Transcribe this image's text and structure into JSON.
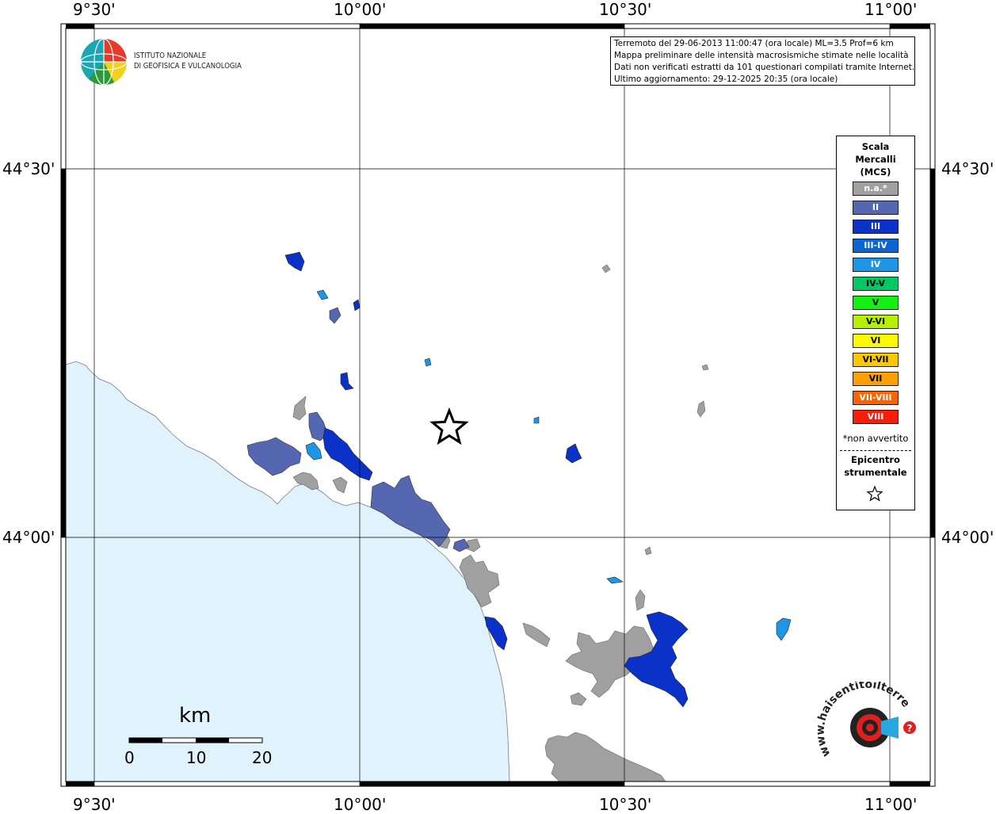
{
  "map": {
    "lon_labels": [
      "9°30'",
      "10°00'",
      "10°30'",
      "11°00'"
    ],
    "lat_labels": [
      "44°30'",
      "44°00'"
    ],
    "colors": {
      "sea": "#e0f2fc",
      "land": "#ffffff",
      "not_felt": "#a0a0a0",
      "II": "#5567b0",
      "III": "#0a32c8",
      "IV": "#1e96e6"
    }
  },
  "org": {
    "name_line1": "ISTITUTO NAZIONALE",
    "name_line2": "DI GEOFISICA E VULCANOLOGIA"
  },
  "info": {
    "line1": "Terremoto del 29-06-2013 11:00:47 (ora locale) ML=3.5 Prof=6 km",
    "line2": "Mappa preliminare delle intensità macrosismiche stimate nelle località",
    "line3": "Dati non verificati estratti da 101 questionari compilati tramite Internet.",
    "line4": "Ultimo aggiornamento: 29-12-2025 20:35 (ora locale)"
  },
  "legend": {
    "title_line1": "Scala",
    "title_line2": "Mercalli",
    "title_line3": "(MCS)",
    "classes": [
      {
        "label": "n.a.*",
        "color": "#a0a0a0",
        "text_color": "#ffffff"
      },
      {
        "label": "II",
        "color": "#5567b0",
        "text_color": "#ffffff"
      },
      {
        "label": "III",
        "color": "#0a32c8",
        "text_color": "#ffffff"
      },
      {
        "label": "III-IV",
        "color": "#0a64d2",
        "text_color": "#ffffff"
      },
      {
        "label": "IV",
        "color": "#1e96e6",
        "text_color": "#ffffff"
      },
      {
        "label": "IV-V",
        "color": "#00c864",
        "text_color": "#000000"
      },
      {
        "label": "V",
        "color": "#14f014",
        "text_color": "#000000"
      },
      {
        "label": "V-VI",
        "color": "#b4f000",
        "text_color": "#000000"
      },
      {
        "label": "VI",
        "color": "#fafa00",
        "text_color": "#000000"
      },
      {
        "label": "VI-VII",
        "color": "#fac800",
        "text_color": "#000000"
      },
      {
        "label": "VII",
        "color": "#faa000",
        "text_color": "#000000"
      },
      {
        "label": "VII-VIII",
        "color": "#fa6400",
        "text_color": "#ffffff"
      },
      {
        "label": "VIII",
        "color": "#fa1e0a",
        "text_color": "#ffffff"
      }
    ],
    "note": "*non avvertito",
    "epicenter_line1": "Epicentro",
    "epicenter_line2": "strumentale"
  },
  "scale_bar": {
    "unit": "km",
    "labels": [
      "0",
      "10",
      "20"
    ]
  },
  "promo": {
    "website": "www.haisentitoilterremoto.it",
    "mark": "?"
  }
}
